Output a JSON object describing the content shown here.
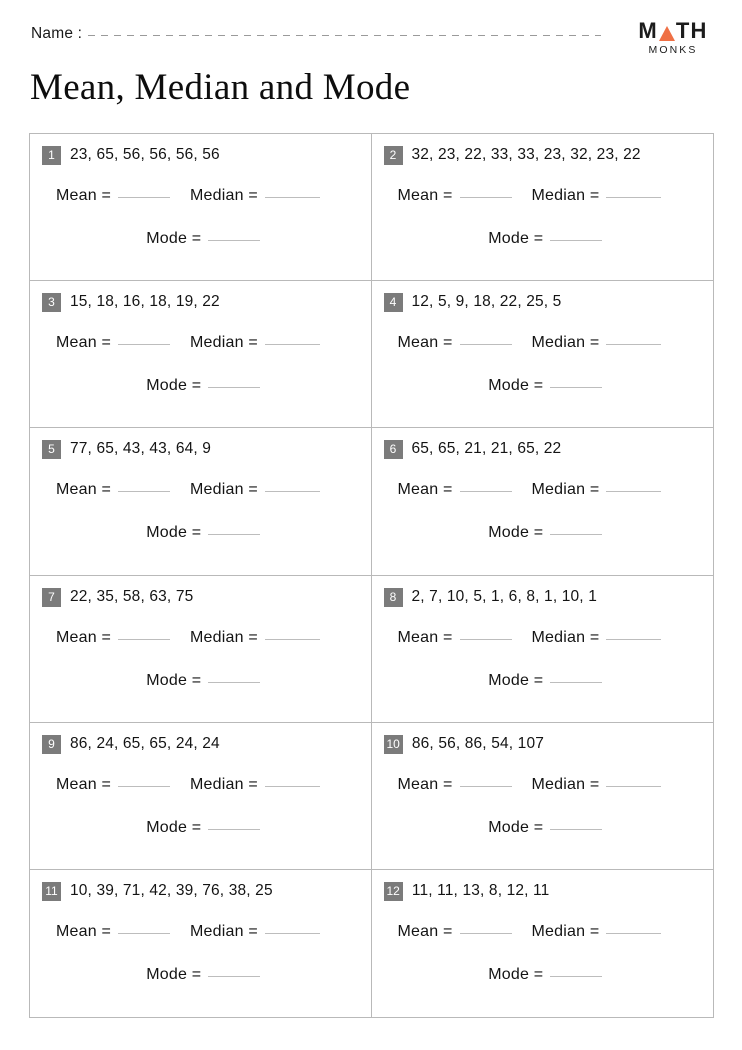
{
  "header": {
    "name_label": "Name :",
    "logo": {
      "line1_before": "M",
      "line1_after": "TH",
      "line2": "MONKS",
      "triangle_color": "#ef7045"
    }
  },
  "title": "Mean, Median and Mode",
  "labels": {
    "mean": "Mean =",
    "median": "Median =",
    "mode": "Mode ="
  },
  "colors": {
    "badge_bg": "#7b7b7b",
    "badge_text": "#ffffff",
    "grid_border": "#b9b9b9",
    "blank_line": "#bdbdbd",
    "text": "#141414",
    "accent": "#ef7045"
  },
  "problems": [
    {
      "number": "1",
      "values": "23, 65, 56, 56, 56, 56"
    },
    {
      "number": "2",
      "values": "32, 23, 22, 33, 33, 23, 32, 23, 22"
    },
    {
      "number": "3",
      "values": "15, 18, 16, 18, 19, 22"
    },
    {
      "number": "4",
      "values": "12, 5, 9, 18, 22, 25, 5"
    },
    {
      "number": "5",
      "values": "77, 65, 43, 43, 64, 9"
    },
    {
      "number": "6",
      "values": "65, 65, 21, 21, 65, 22"
    },
    {
      "number": "7",
      "values": "22, 35, 58, 63, 75"
    },
    {
      "number": "8",
      "values": "2, 7, 10, 5, 1, 6, 8, 1, 10, 1"
    },
    {
      "number": "9",
      "values": "86, 24, 65, 65, 24, 24"
    },
    {
      "number": "10",
      "values": "86, 56, 86, 54, 107"
    },
    {
      "number": "11",
      "values": "10, 39, 71, 42, 39, 76, 38, 25"
    },
    {
      "number": "12",
      "values": "11, 11, 13, 8, 12, 11"
    }
  ]
}
